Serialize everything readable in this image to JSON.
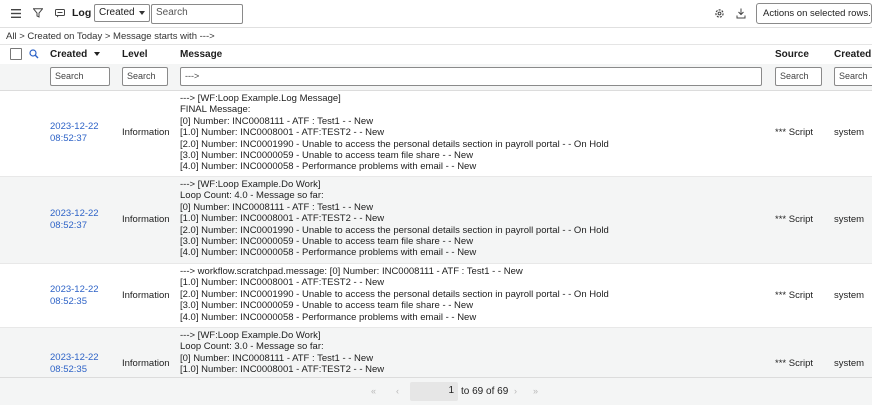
{
  "toolbar": {
    "title": "Log",
    "filter_select": "Created",
    "search_placeholder": "Search",
    "actions_select": "Actions on selected rows..."
  },
  "breadcrumb": "All > Created on Today > Message starts with --->",
  "columns": {
    "created": "Created",
    "level": "Level",
    "message": "Message",
    "source": "Source",
    "created_by": "Created by"
  },
  "search_row": {
    "created": "Search",
    "level": "Search",
    "message": "--->",
    "source": "Search",
    "created_by": "Search"
  },
  "rows": [
    {
      "date": "2023-12-22",
      "time": "08:52:37",
      "level": "Information",
      "source": "*** Script",
      "created_by": "system",
      "lines": [
        "---> [WF:Loop Example.Log Message]",
        "FINAL Message:",
        "[0] Number: INC0008111 - ATF : Test1 - - New",
        "[1.0] Number: INC0008001 - ATF:TEST2 - - New",
        "[2.0] Number: INC0001990 - Unable to access the personal details section in payroll portal - - On Hold",
        "[3.0] Number: INC0000059 - Unable to access team file share - - New",
        "[4.0] Number: INC0000058 - Performance problems with email - - New"
      ]
    },
    {
      "date": "2023-12-22",
      "time": "08:52:37",
      "level": "Information",
      "source": "*** Script",
      "created_by": "system",
      "lines": [
        "---> [WF:Loop Example.Do Work]",
        "Loop Count: 4.0 - Message so far:",
        "[0] Number: INC0008111 - ATF : Test1 - - New",
        "[1.0] Number: INC0008001 - ATF:TEST2 - - New",
        "[2.0] Number: INC0001990 - Unable to access the personal details section in payroll portal - - On Hold",
        "[3.0] Number: INC0000059 - Unable to access team file share - - New",
        "[4.0] Number: INC0000058 - Performance problems with email - - New"
      ]
    },
    {
      "date": "2023-12-22",
      "time": "08:52:35",
      "level": "Information",
      "source": "*** Script",
      "created_by": "system",
      "lines": [
        "---> workflow.scratchpad.message: [0] Number: INC0008111 - ATF : Test1 - - New",
        "[1.0] Number: INC0008001 - ATF:TEST2 - - New",
        "[2.0] Number: INC0001990 - Unable to access the personal details section in payroll portal - - On Hold",
        "[3.0] Number: INC0000059 - Unable to access team file share - - New",
        "[4.0] Number: INC0000058 - Performance problems with email - - New"
      ]
    },
    {
      "date": "2023-12-22",
      "time": "08:52:35",
      "level": "Information",
      "source": "*** Script",
      "created_by": "system",
      "lines": [
        "---> [WF:Loop Example.Do Work]",
        "Loop Count: 3.0 - Message so far:",
        "[0] Number: INC0008111 - ATF : Test1 - - New",
        "[1.0] Number: INC0008001 - ATF:TEST2 - - New"
      ]
    }
  ],
  "pagination": {
    "current": "1",
    "range_text": "to 69 of 69"
  },
  "icons": [
    "hamburger-icon",
    "filter-icon",
    "comment-icon",
    "search-icon",
    "gear-icon",
    "export-icon",
    "sort-down-icon",
    "first-page-icon",
    "prev-page-icon",
    "next-page-icon",
    "last-page-icon"
  ]
}
